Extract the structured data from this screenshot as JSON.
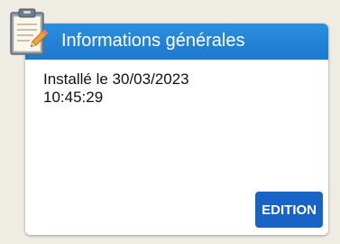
{
  "card": {
    "title": "Informations générales",
    "install_label": "Installé le 30/03/2023",
    "install_time": "10:45:29",
    "edit_label": "EDITION"
  },
  "icons": {
    "header": "clipboard-pencil-icon"
  },
  "colors": {
    "header_blue": "#1d78cc",
    "button_blue": "#1863c6",
    "page_background": "#efece4"
  }
}
